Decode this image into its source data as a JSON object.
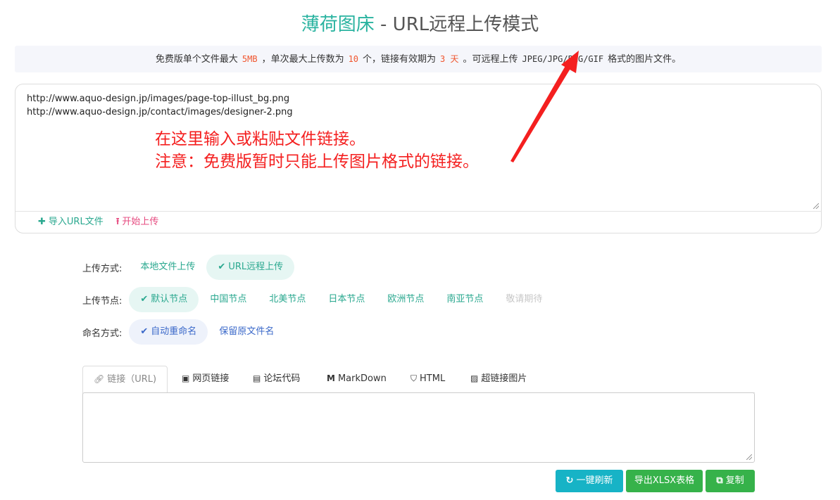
{
  "header": {
    "brand": "薄荷图床",
    "separator": " - ",
    "mode": "URL远程上传模式"
  },
  "notice": {
    "p1": "免费版单个文件最大",
    "max_size": "5MB",
    "p2": "，单次最大上传数为",
    "max_count": "10",
    "p3": "个，链接有效期为",
    "expire": "3 天",
    "p4": "。可远程上传",
    "formats": "JPEG/JPG/PNG/GIF",
    "p5": "格式的图片文件。"
  },
  "url_input": {
    "lines": [
      "http://www.aquo-design.jp/images/page-top-illust_bg.png",
      "http://www.aquo-design.jp/contact/images/designer-2.png"
    ],
    "import_label": "导入URL文件",
    "upload_label": "开始上传"
  },
  "annotation": {
    "line1": "在这里输入或粘贴文件链接。",
    "line2": "注意：免费版暂时只能上传图片格式的链接。",
    "color": "#f41f1f"
  },
  "upload_method": {
    "label": "上传方式:",
    "options": [
      "本地文件上传",
      "URL远程上传"
    ],
    "selected": "URL远程上传"
  },
  "upload_node": {
    "label": "上传节点:",
    "options": [
      "默认节点",
      "中国节点",
      "北美节点",
      "日本节点",
      "欧洲节点",
      "南亚节点",
      "敬请期待"
    ],
    "selected": "默认节点"
  },
  "naming": {
    "label": "命名方式:",
    "options": [
      "自动重命名",
      "保留原文件名"
    ],
    "selected": "自动重命名"
  },
  "output_tabs": [
    {
      "label": "链接（URL)",
      "icon": "link-icon"
    },
    {
      "label": "网页链接",
      "icon": "image-icon"
    },
    {
      "label": "论坛代码",
      "icon": "comment-icon"
    },
    {
      "label": "MarkDown",
      "icon": "markdown-icon"
    },
    {
      "label": "HTML",
      "icon": "html5-icon"
    },
    {
      "label": "超链接图片",
      "icon": "picture-icon"
    }
  ],
  "buttons": {
    "refresh": "一键刷新",
    "export": "导出XLSX表格",
    "copy": "复制"
  },
  "colors": {
    "accent": "#2ab3a0",
    "highlight": "#f0562f",
    "refresh": "#17b3c6",
    "green": "#36b24a",
    "link_blue": "#3a68c9"
  }
}
